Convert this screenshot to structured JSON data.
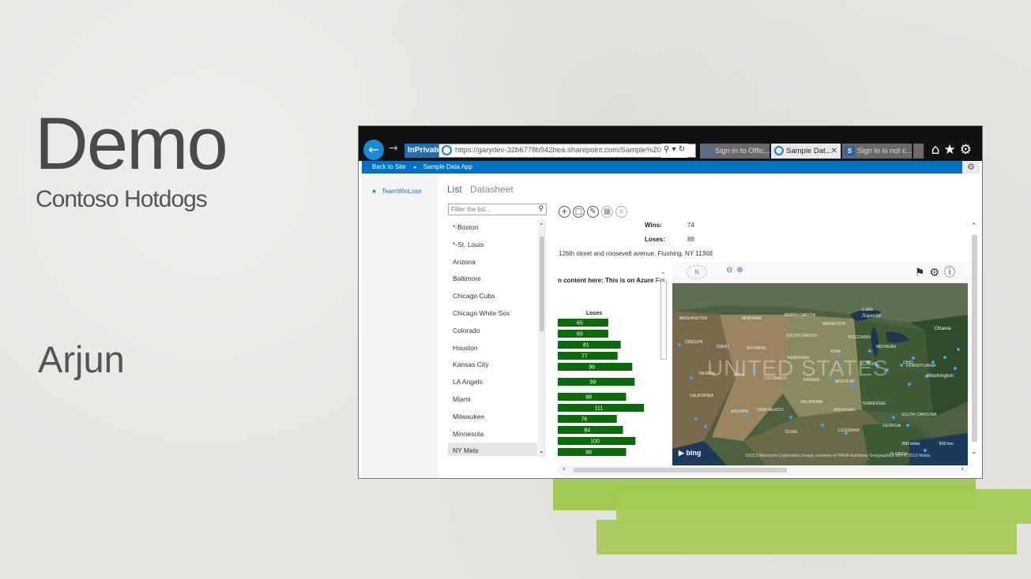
{
  "slide": {
    "title": "Demo",
    "subtitle": "Contoso Hotdogs",
    "presenter": "Arjun",
    "accent_color": "#9cc447"
  },
  "browser": {
    "inprivate_label": "InPrivate",
    "address": "https://garydev-32b6778b942bea.sharepoint.com/Sample%20Da",
    "tabs": [
      {
        "label": "Sign in to Offic..."
      },
      {
        "label": "Sample Dat..."
      },
      {
        "label": "Sign in is not c..."
      }
    ]
  },
  "suitebar": {
    "back_label": "Back to Site",
    "app_label": "Sample Data App"
  },
  "leftnav": {
    "items": [
      {
        "label": "TeamWinLose"
      }
    ]
  },
  "views": {
    "list": "List",
    "datasheet": "Datasheet"
  },
  "filter": {
    "placeholder": "Filter the list..."
  },
  "teams": [
    "*-Boston",
    "*-St. Louis",
    "Arizona",
    "Baltimore",
    "Chicago Cubs",
    "Chicago White Sox",
    "Colorado",
    "Houston",
    "Kansas City",
    "LA Angels",
    "Miami",
    "Milwaukee",
    "Minnesota",
    "NY Mets"
  ],
  "selected_team": "NY Mets",
  "record": {
    "wins_label": "Wins:",
    "wins": "74",
    "loses_label": "Loses:",
    "loses": "88",
    "address": "126th street and roosevelt avenue, Flushing, NY 11368"
  },
  "embed": {
    "bold_text": "n content here: This is on Azure",
    "rest_text": " For"
  },
  "chart_data": {
    "type": "bar",
    "title": "Loses",
    "values": [
      65,
      65,
      81,
      77,
      96,
      99,
      88,
      111,
      76,
      84,
      100,
      88
    ],
    "bar_color": "#0b6b0b"
  },
  "map": {
    "country_label": "UNITED STATES",
    "provider": "bing",
    "copyright": "©2013 Microsoft Corporation    Image courtesy of NASA    Earthstar Geographics SIO    © 2013 Nokia",
    "scale_miles": "250 miles",
    "scale_km": "500 km",
    "nav_label": "N",
    "labels": [
      "WASHINGTON",
      "MONTANA",
      "NORTH DAKOTA",
      "MINNESOTA",
      "OREGON",
      "IDAHO",
      "SOUTH DAKOTA",
      "WISCONSIN",
      "WYOMING",
      "NEBRASKA",
      "IOWA",
      "MICHIGAN",
      "NEVADA",
      "UTAH",
      "COLORADO",
      "KANSAS",
      "MISSOURI",
      "ILLINOIS",
      "OHIO",
      "CALIFORNIA",
      "ARIZONA",
      "NEW MEXICO",
      "OKLAHOMA",
      "ARKANSAS",
      "TENNESSEE",
      "TEXAS",
      "LOUISIANA",
      "GEORGIA",
      "FLORIDA",
      "Ottawa",
      "Washington",
      "Lake Superior",
      "PENNSYLVANIA",
      "SOUTH CAROLINA"
    ]
  }
}
